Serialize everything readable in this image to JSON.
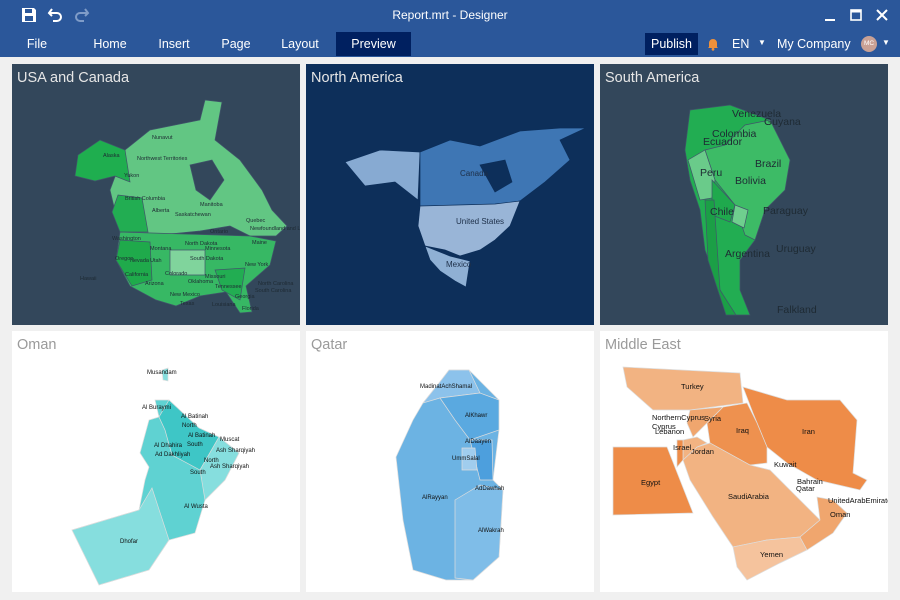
{
  "window": {
    "title": "Report.mrt - Designer"
  },
  "quick_access": [
    {
      "icon": "save-icon"
    },
    {
      "icon": "undo-icon"
    },
    {
      "icon": "redo-icon"
    }
  ],
  "menu": {
    "tabs": [
      {
        "label": "File"
      },
      {
        "label": "Home"
      },
      {
        "label": "Insert"
      },
      {
        "label": "Page"
      },
      {
        "label": "Layout"
      },
      {
        "label": "Preview",
        "active": true
      }
    ],
    "publish": "Publish",
    "language": "EN",
    "company": "My Company",
    "avatar_initials": "MC"
  },
  "colors": {
    "ribbon": "#2b579a",
    "active_tab": "#002060",
    "notification": "#f0913a",
    "avatar": "#c9a195"
  },
  "panels": [
    {
      "title": "USA and Canada",
      "labels": [
        "Alaska",
        "Yukon",
        "Northwest Territories",
        "Nunavut",
        "British Columbia",
        "Alberta",
        "Saskatchewan",
        "Manitoba",
        "Ontario",
        "Quebec",
        "Newfoundland and Labrador",
        "Washington",
        "Oregon",
        "Montana",
        "North Dakota",
        "South Dakota",
        "Minnesota",
        "Nevada",
        "Utah",
        "California",
        "Colorado",
        "Arizona",
        "New Mexico",
        "Texas",
        "Oklahoma",
        "Missouri",
        "Tennessee",
        "New York",
        "Maine",
        "North Carolina",
        "South Carolina",
        "Georgia",
        "Louisiana",
        "Florida",
        "Hawaii"
      ]
    },
    {
      "title": "North America",
      "labels": [
        "Canada",
        "United States",
        "Mexico"
      ]
    },
    {
      "title": "South America",
      "labels": [
        "Venezuela",
        "Guyana",
        "Colombia",
        "Ecuador",
        "Peru",
        "Brazil",
        "Bolivia",
        "Chile",
        "Paraguay",
        "Argentina",
        "Uruguay",
        "Falkland"
      ]
    },
    {
      "title": "Oman",
      "labels": [
        "Musandam",
        "Al Buraymi",
        "Al Batinah",
        "North",
        "Al Batinah",
        "South",
        "Muscat",
        "Al Dhahira",
        "Ad Dakhliyah",
        "Ash Sharqiyah",
        "North",
        "Ash Sharqiyah",
        "South",
        "Al Wusta",
        "Dhofar"
      ]
    },
    {
      "title": "Qatar",
      "labels": [
        "MadinatAchShamal",
        "AlKhawr",
        "AlDaayen",
        "UmmSalal",
        "AdDawhah",
        "AlRayyan",
        "AlWakrah"
      ]
    },
    {
      "title": "Middle East",
      "labels": [
        "Turkey",
        "NorthernCyprus",
        "Cyprus",
        "Lebanon",
        "Syria",
        "Iraq",
        "Iran",
        "Israel",
        "Jordan",
        "Kuwait",
        "Bahrain",
        "Qatar",
        "UnitedArabEmirates",
        "Oman",
        "Egypt",
        "SaudiArabia",
        "Yemen"
      ]
    }
  ]
}
